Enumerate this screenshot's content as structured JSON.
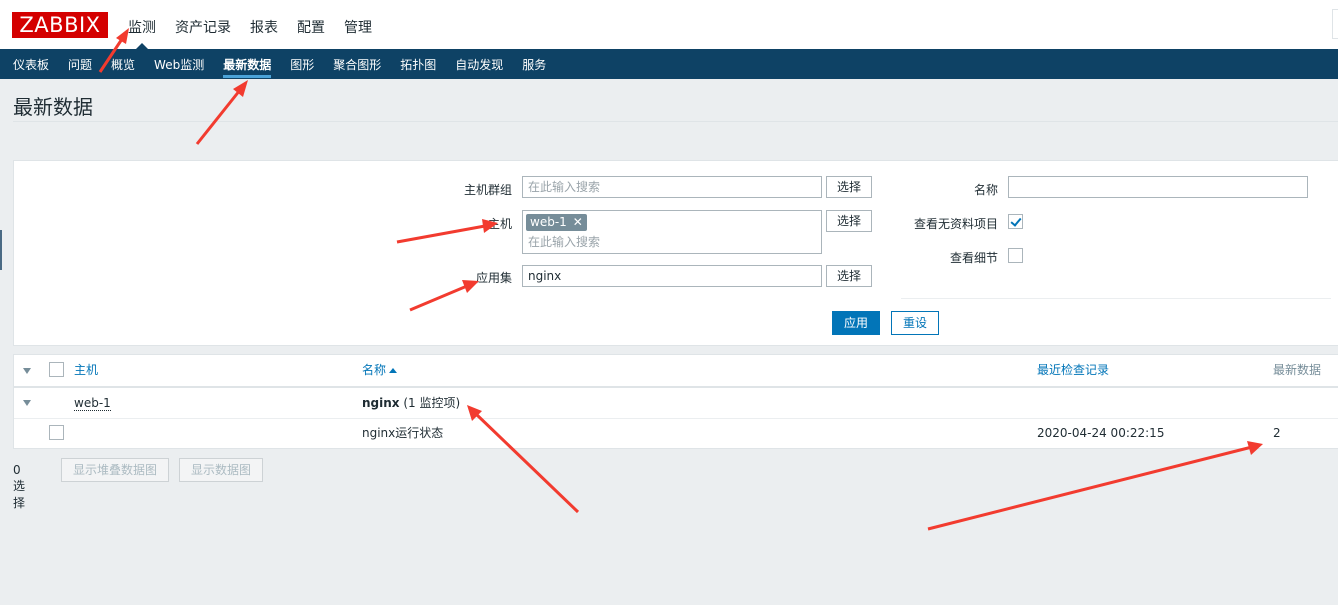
{
  "header": {
    "logo": "ZABBIX",
    "main_nav": [
      "监测",
      "资产记录",
      "报表",
      "配置",
      "管理"
    ],
    "active_main": 0
  },
  "subnav": {
    "items": [
      "仪表板",
      "问题",
      "概览",
      "Web监测",
      "最新数据",
      "图形",
      "聚合图形",
      "拓扑图",
      "自动发现",
      "服务"
    ],
    "active": 4
  },
  "page_title": "最新数据",
  "filter": {
    "host_group_label": "主机群组",
    "host_group_placeholder": "在此输入搜索",
    "host_label": "主机",
    "host_tag": "web-1",
    "host_placeholder": "在此输入搜索",
    "app_label": "应用集",
    "app_value": "nginx",
    "select_label": "选择",
    "name_label": "名称",
    "name_value": "",
    "show_no_data_label": "查看无资料项目",
    "show_no_data_checked": true,
    "show_details_label": "查看细节",
    "show_details_checked": false,
    "apply_label": "应用",
    "reset_label": "重设"
  },
  "table": {
    "headers": {
      "host": "主机",
      "name": "名称",
      "last_check": "最近检查记录",
      "last_value": "最新数据"
    },
    "group_row": {
      "host": "web-1",
      "app_name": "nginx",
      "app_count": "(1 监控项)"
    },
    "item_rows": [
      {
        "name": "nginx运行状态",
        "last_check": "2020-04-24 00:22:15",
        "last_value": "2"
      }
    ]
  },
  "footer": {
    "selected": "0 选择",
    "btn_stacked": "显示堆叠数据图",
    "btn_graph": "显示数据图"
  },
  "colors": {
    "logo_red": "#d40000",
    "nav_dark": "#0e4265",
    "link_blue": "#0275b8",
    "annotation_red": "#f23b2f"
  }
}
